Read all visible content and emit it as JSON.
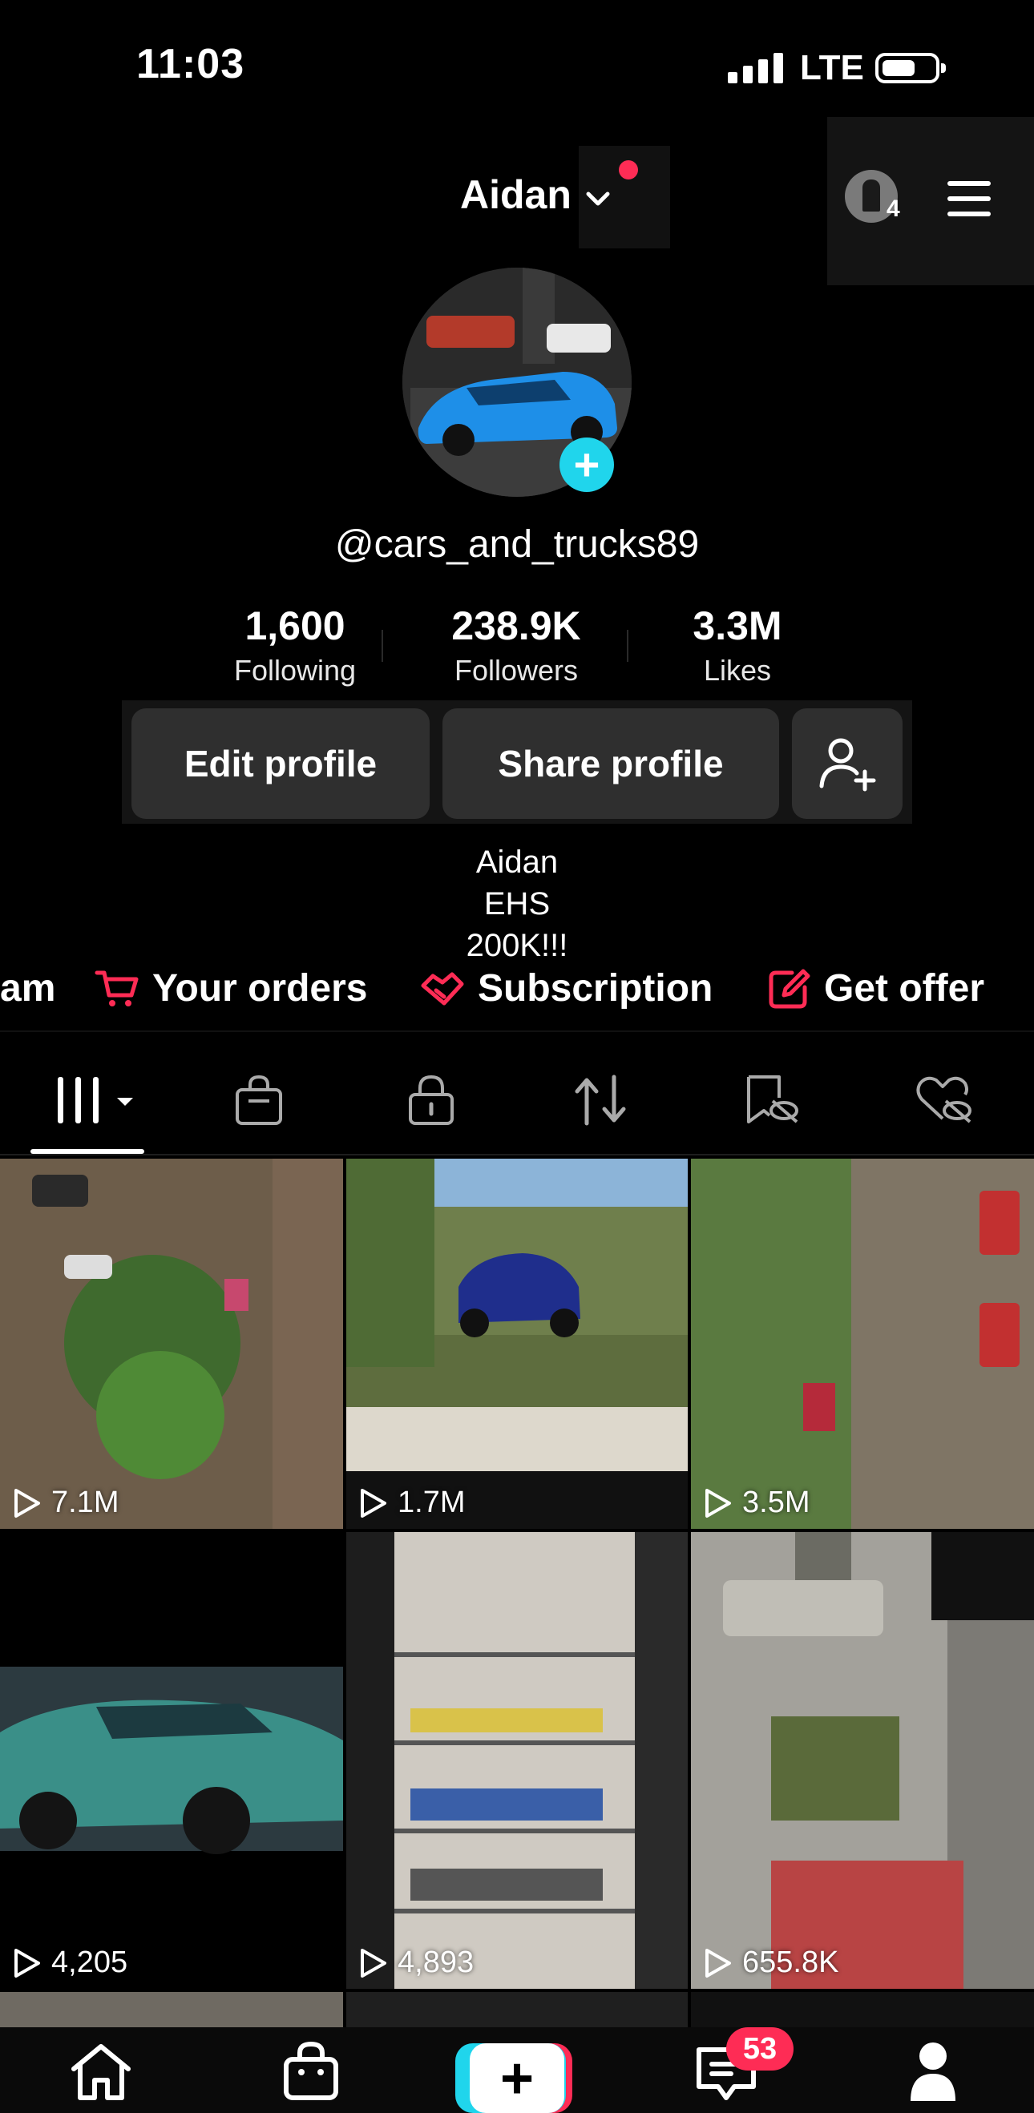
{
  "status_bar": {
    "time": "11:03",
    "network": "LTE"
  },
  "header": {
    "account_name": "Aidan",
    "accounts_count": "4"
  },
  "profile": {
    "handle": "@cars_and_trucks89",
    "stats": [
      {
        "value": "1,600",
        "label": "Following"
      },
      {
        "value": "238.9K",
        "label": "Followers"
      },
      {
        "value": "3.3M",
        "label": "Likes"
      }
    ],
    "edit_label": "Edit profile",
    "share_label": "Share profile",
    "bio": [
      "Aidan",
      "EHS",
      "200K!!!"
    ]
  },
  "promo": {
    "items": [
      {
        "label": "am",
        "icon": "cut-off-text"
      },
      {
        "label": "Your orders",
        "icon": "cart-icon"
      },
      {
        "label": "Subscription",
        "icon": "handshake-icon"
      },
      {
        "label": "Get offer",
        "icon": "edit-square-icon"
      }
    ],
    "accent": "#fe2c55"
  },
  "tabs": [
    {
      "name": "videos-grid-icon"
    },
    {
      "name": "shop-bag-icon"
    },
    {
      "name": "private-lock-icon"
    },
    {
      "name": "reposts-icon"
    },
    {
      "name": "favorites-hidden-icon"
    },
    {
      "name": "liked-hidden-icon"
    }
  ],
  "videos": [
    {
      "views": "7.1M"
    },
    {
      "views": "1.7M"
    },
    {
      "views": "3.5M"
    },
    {
      "views": "4,205"
    },
    {
      "views": "4,893"
    },
    {
      "views": "655.8K"
    }
  ],
  "bottom_nav": {
    "items": [
      "home-icon",
      "shop-icon",
      "create-icon",
      "inbox-icon",
      "profile-icon"
    ],
    "inbox_badge": "53"
  },
  "colors": {
    "background": "#000000",
    "brand_red": "#fe2c55",
    "brand_cyan": "#20d5ec",
    "button_gray": "#2f2f2f"
  }
}
